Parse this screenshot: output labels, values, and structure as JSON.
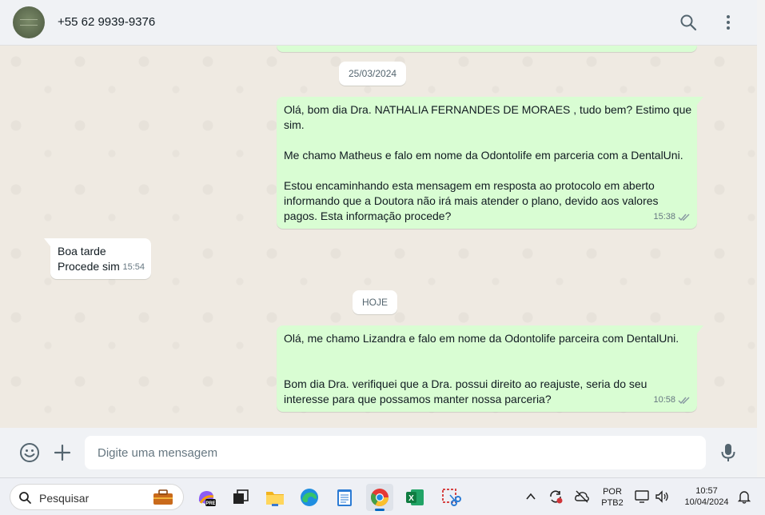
{
  "header": {
    "contact_name": "+55 62 9939-9376",
    "avatar_icon": "avatar-logo",
    "search_icon": "search-icon",
    "menu_icon": "more-vertical-icon"
  },
  "chat": {
    "date_chip_1": "25/03/2024",
    "msg1": {
      "lines": [
        "Olá, bom dia Dra. NATHALIA FERNANDES DE MORAES , tudo bem? Estimo que",
        "sim.",
        "",
        "Me chamo Matheus e falo em nome da Odontolife em parceria com a DentalUni.",
        "",
        "Estou encaminhando esta mensagem em resposta ao protocolo em aberto",
        "informando que a Doutora não irá mais atender o plano, devido aos valores",
        "pagos. Esta informação procede?"
      ],
      "time": "15:38",
      "status": "double-check-icon"
    },
    "msg2": {
      "lines": [
        "Boa tarde",
        "Procede sim"
      ],
      "time": "15:54"
    },
    "date_chip_2": "HOJE",
    "msg3": {
      "lines": [
        "Olá, me chamo Lizandra e falo em nome da Odontolife parceira com DentalUni.",
        "",
        "",
        "Bom dia Dra. verifiquei que a Dra. possui direito ao reajuste, seria do seu",
        "interesse para que possamos manter nossa parceria?"
      ],
      "time": "10:58",
      "status": "double-check-icon"
    }
  },
  "composer": {
    "placeholder": "Digite uma mensagem",
    "emoji_icon": "emoji-icon",
    "attach_icon": "plus-icon",
    "mic_icon": "microphone-icon"
  },
  "taskbar": {
    "search_label": "Pesquisar",
    "apps": [
      "briefcase-icon",
      "copilot-pre-icon",
      "task-view-icon",
      "file-explorer-icon",
      "edge-icon",
      "notepad-icon",
      "chrome-icon",
      "excel-icon",
      "snipping-tool-icon"
    ],
    "tray": {
      "language_top": "POR",
      "language_bottom": "PTB2",
      "time": "10:57",
      "date": "10/04/2024"
    }
  },
  "colors": {
    "outgoing_bubble": "#d9fdd3",
    "incoming_bubble": "#ffffff",
    "chat_bg": "#efeae2",
    "header_bg": "#f0f2f5",
    "read_check": "#8696a0"
  }
}
